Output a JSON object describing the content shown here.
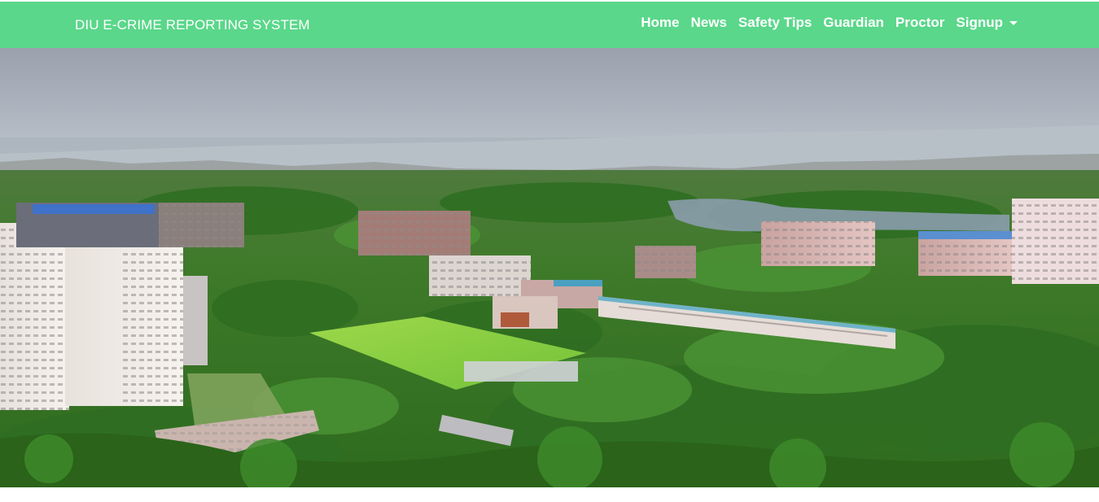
{
  "navbar": {
    "brand": "DIU E-CRIME REPORTING SYSTEM",
    "background_color": "#5ad78a",
    "links": [
      {
        "label": "Home"
      },
      {
        "label": "News"
      },
      {
        "label": "Safety Tips"
      },
      {
        "label": "Guardian"
      },
      {
        "label": "Proctor"
      }
    ],
    "dropdown": {
      "label": "Signup",
      "icon": "caret-down-icon"
    }
  },
  "hero": {
    "image_subject": "aerial campus photo"
  }
}
